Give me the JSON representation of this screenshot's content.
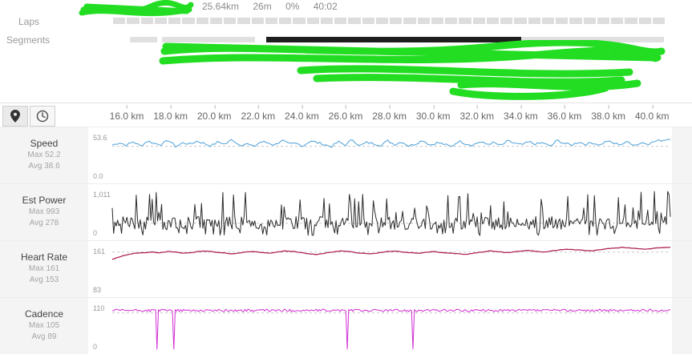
{
  "summary": {
    "distance": "25.64km",
    "time": "26m",
    "grade": "0%",
    "elapsed": "40:02"
  },
  "labels": {
    "laps": "Laps",
    "segments": "Segments"
  },
  "toolbar": {
    "map_icon": "map-pin-icon",
    "time_icon": "clock-icon"
  },
  "colors": {
    "speed": "#4a9fd8",
    "power": "#2b2b2b",
    "heart_rate": "#b0235a",
    "cadence": "#d12fd2",
    "redaction": "#22dd22"
  },
  "chart_data": [
    {
      "type": "line",
      "name": "Speed",
      "x_ticks": [
        "16.0 km",
        "18.0 km",
        "20.0 km",
        "22.0 km",
        "24.0 km",
        "26.0 km",
        "28.0 km",
        "30.0 km",
        "32.0 km",
        "34.0 km",
        "36.0 km",
        "38.0 km",
        "40.0 km"
      ],
      "ylim": [
        0.0,
        53.6
      ],
      "y_top_label": "53.6",
      "y_bottom_label": "0.0",
      "max_label": "Max 52.2",
      "avg_label": "Avg 38.6",
      "avg": 38.6,
      "max": 52.2,
      "min_plot": 30,
      "series_profile": [
        40,
        43,
        40,
        44,
        39,
        45,
        42,
        41,
        46,
        38,
        43,
        41,
        45,
        42,
        39,
        44,
        41,
        47,
        40,
        42,
        38,
        44,
        43,
        40,
        46,
        41,
        42,
        39,
        45,
        43,
        41,
        38,
        44,
        40,
        47,
        39,
        43,
        42,
        40,
        45,
        41,
        44,
        39,
        42,
        46,
        40,
        43,
        41,
        38,
        45,
        42,
        40,
        44,
        41,
        43,
        39,
        45,
        42,
        40,
        44,
        41,
        43,
        38,
        46,
        42,
        40,
        44,
        41,
        43,
        40,
        45,
        42,
        41,
        44,
        40,
        43,
        42,
        45,
        46,
        48
      ]
    },
    {
      "type": "line",
      "name": "Est Power",
      "ylim": [
        0,
        1011
      ],
      "y_top_label": "1,011",
      "y_bottom_label": "0",
      "max_label": "Max 993",
      "avg_label": "Avg 278",
      "avg": 278,
      "max": 993
    },
    {
      "type": "line",
      "name": "Heart Rate",
      "ylim": [
        83,
        161
      ],
      "y_top_label": "161",
      "y_bottom_label": "83",
      "max_label": "Max 161",
      "avg_label": "Avg 153",
      "avg": 153,
      "max": 161,
      "series_profile": [
        140,
        145,
        149,
        151,
        152,
        153,
        152,
        154,
        153,
        151,
        152,
        154,
        155,
        153,
        152,
        150,
        151,
        153,
        154,
        152,
        151,
        153,
        155,
        154,
        152,
        150,
        149,
        151,
        153,
        155,
        154,
        152,
        151,
        150,
        152,
        154,
        155,
        153,
        152,
        151,
        153,
        154,
        152,
        151,
        150,
        149,
        151,
        153,
        155,
        154,
        152,
        153,
        155,
        156,
        154,
        153,
        155,
        157,
        158,
        157,
        156,
        155,
        157,
        159,
        160,
        161,
        160,
        159,
        158,
        160,
        161,
        161
      ]
    },
    {
      "type": "line",
      "name": "Cadence",
      "ylim": [
        0,
        110
      ],
      "y_top_label": "110",
      "y_bottom_label": "0",
      "max_label": "Max 105",
      "avg_label": "Avg 89",
      "avg": 89,
      "max": 105,
      "dropouts": [
        0.08,
        0.11,
        0.42,
        0.54
      ]
    }
  ]
}
